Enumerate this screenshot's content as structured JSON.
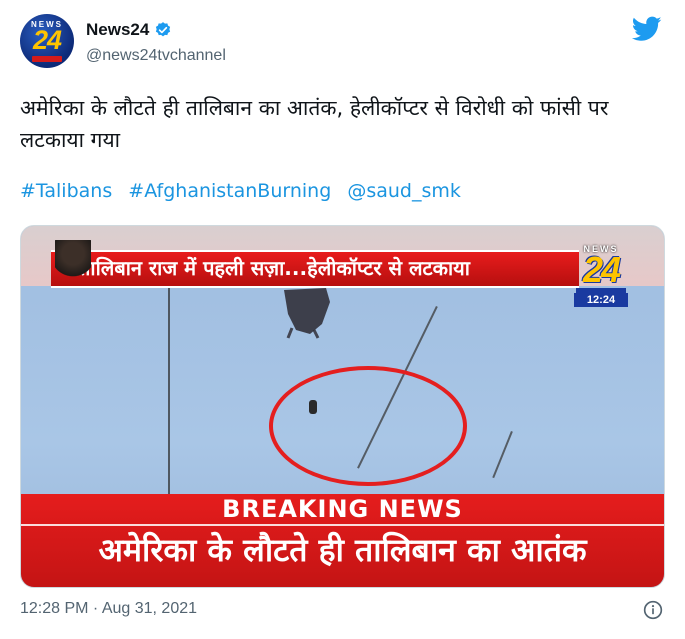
{
  "account": {
    "display_name": "News24",
    "handle": "@news24tvchannel",
    "avatar_text": "NEWS",
    "avatar_number": "24",
    "verified": true
  },
  "tweet": {
    "text": "अमेरिका के लौटते ही तालिबान का आतंक, हेलीकॉप्टर से विरोधी को फांसी पर लटकाया गया",
    "hashtags": [
      "#Talibans",
      "#AfghanistanBurning",
      "@saud_smk"
    ],
    "timestamp": "12:28 PM · Aug 31, 2021"
  },
  "media": {
    "top_banner": "तालिबान राज में पहली सज़ा...हेलीकॉप्टर से लटकाया",
    "logo_news": "NEWS",
    "logo_number": "24",
    "clock": "12:24",
    "breaking_label": "BREAKING NEWS",
    "breaking_headline": "अमेरिका के लौटते ही तालिबान का आतंक"
  },
  "colors": {
    "link": "#1b95e0",
    "verified": "#1d9bf0",
    "twitter": "#1d9bf0",
    "breaking_red": "#e51d1d",
    "circle_red": "#e41f1f"
  },
  "icons": {
    "verified": "verified-badge-icon",
    "brand": "twitter-bird-icon",
    "info": "info-icon"
  }
}
